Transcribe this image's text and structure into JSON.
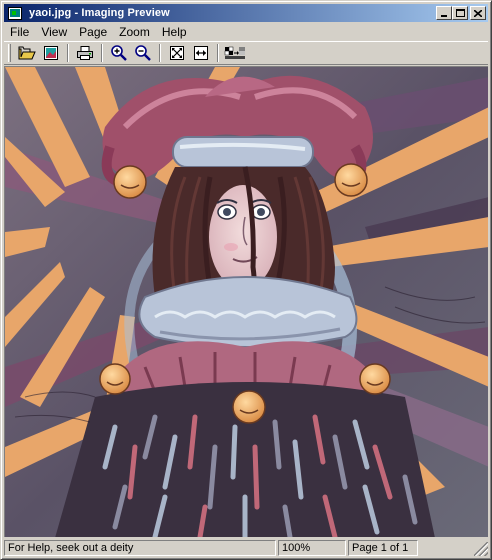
{
  "window": {
    "title": "yaoi.jpg - Imaging Preview",
    "controls": {
      "minimize": "_",
      "maximize": "□",
      "close": "×"
    }
  },
  "menu": {
    "items": [
      "File",
      "View",
      "Page",
      "Zoom",
      "Help"
    ]
  },
  "toolbar": {
    "buttons": [
      {
        "name": "open",
        "icon": "folder-open-icon"
      },
      {
        "name": "image-properties",
        "icon": "image-icon"
      },
      {
        "name": "print",
        "icon": "printer-icon"
      },
      {
        "name": "zoom-in",
        "icon": "zoom-in-icon"
      },
      {
        "name": "zoom-out",
        "icon": "zoom-out-icon"
      },
      {
        "name": "best-fit",
        "icon": "best-fit-icon"
      },
      {
        "name": "fit-to-width",
        "icon": "fit-width-icon"
      },
      {
        "name": "scale-to-gray",
        "icon": "scale-to-gray-icon"
      }
    ]
  },
  "image": {
    "description_colors": {
      "background": "#6e6e7a",
      "sun_rays": "#e8a66a",
      "hat": "#a0506a",
      "hair": "#4a2a2a",
      "skin": "#e8c8c8",
      "collar": "#b8c4d8"
    }
  },
  "status": {
    "message": "For Help, seek out a deity",
    "zoom": "100%",
    "page": "Page 1 of 1"
  }
}
